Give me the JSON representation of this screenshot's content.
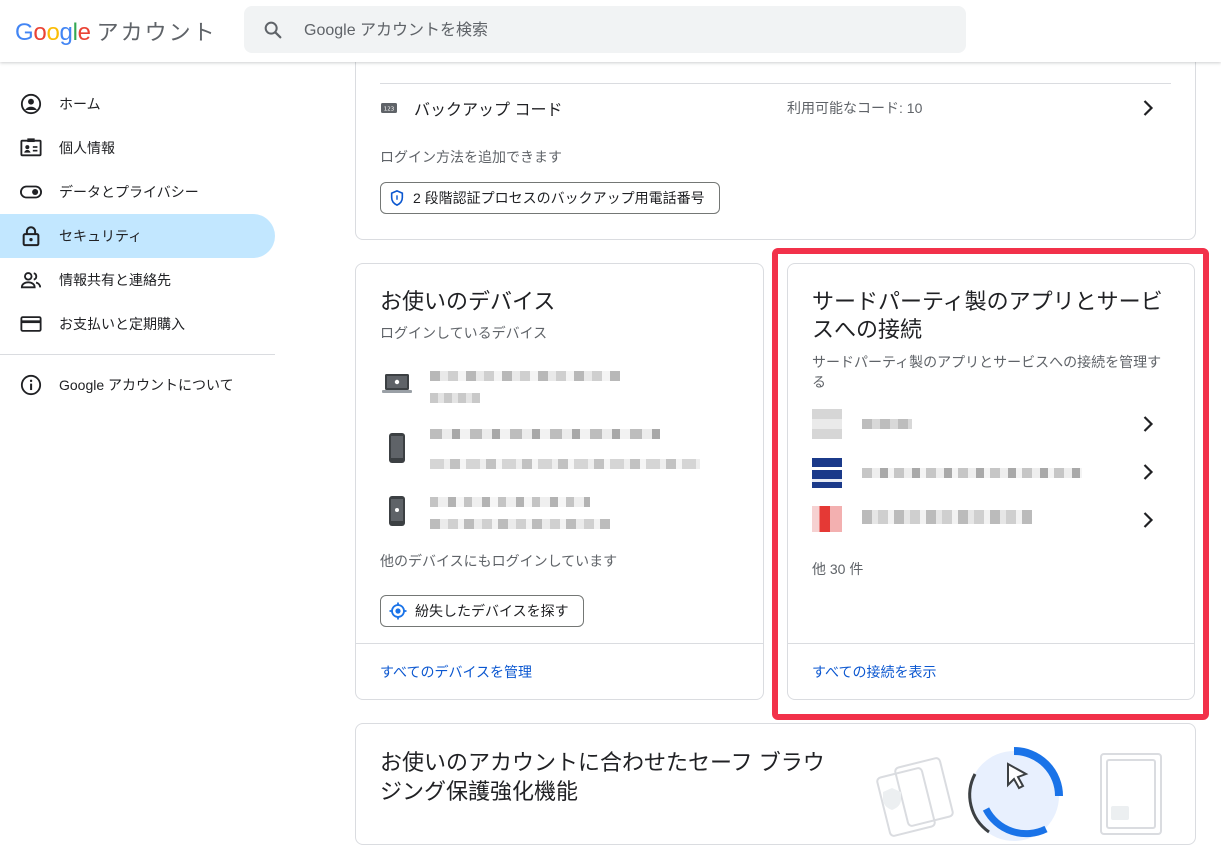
{
  "header": {
    "logo_text": [
      "G",
      "o",
      "o",
      "g",
      "l",
      "e"
    ],
    "logo_suffix": "アカウント",
    "search_placeholder": "Google アカウントを検索"
  },
  "sidebar": {
    "items": [
      {
        "label": "ホーム",
        "icon": "home-icon"
      },
      {
        "label": "個人情報",
        "icon": "person-card-icon"
      },
      {
        "label": "データとプライバシー",
        "icon": "toggle-icon"
      },
      {
        "label": "セキュリティ",
        "icon": "lock-icon",
        "active": true
      },
      {
        "label": "情報共有と連絡先",
        "icon": "people-icon"
      },
      {
        "label": "お支払いと定期購入",
        "icon": "credit-card-icon"
      }
    ],
    "about": {
      "label": "Google アカウントについて",
      "icon": "info-icon"
    }
  },
  "top_card": {
    "backup": {
      "label": "バックアップ コード",
      "count": "利用可能なコード: 10",
      "icon": "backup-codes-icon"
    },
    "add_text": "ログイン方法を追加できます",
    "chip": "2 段階認証プロセスのバックアップ用電話番号"
  },
  "devices_card": {
    "title": "お使いのデバイス",
    "subtitle": "ログインしているデバイス",
    "devices": [
      {
        "icon": "laptop-icon"
      },
      {
        "icon": "phone-icon"
      },
      {
        "icon": "iphone-icon"
      }
    ],
    "other_text": "他のデバイスにもログインしています",
    "find_button": "紛失したデバイスを探す",
    "footer_link": "すべてのデバイスを管理"
  },
  "apps_card": {
    "title": "サードパーティ製のアプリとサービスへの接続",
    "subtitle": "サードパーティ製のアプリとサービスへの接続を管理する",
    "apps": [
      {
        "icon": "app-gray-icon"
      },
      {
        "icon": "app-blue-icon"
      },
      {
        "icon": "app-red-icon"
      }
    ],
    "more_text": "他 30 件",
    "footer_link": "すべての接続を表示"
  },
  "safe_card": {
    "title": "お使いのアカウントに合わせたセーフ ブラウジング保護強化機能"
  },
  "colors": {
    "accent": "#0b57d0",
    "active_nav": "#c2e7ff",
    "highlight": "#f2314a"
  }
}
